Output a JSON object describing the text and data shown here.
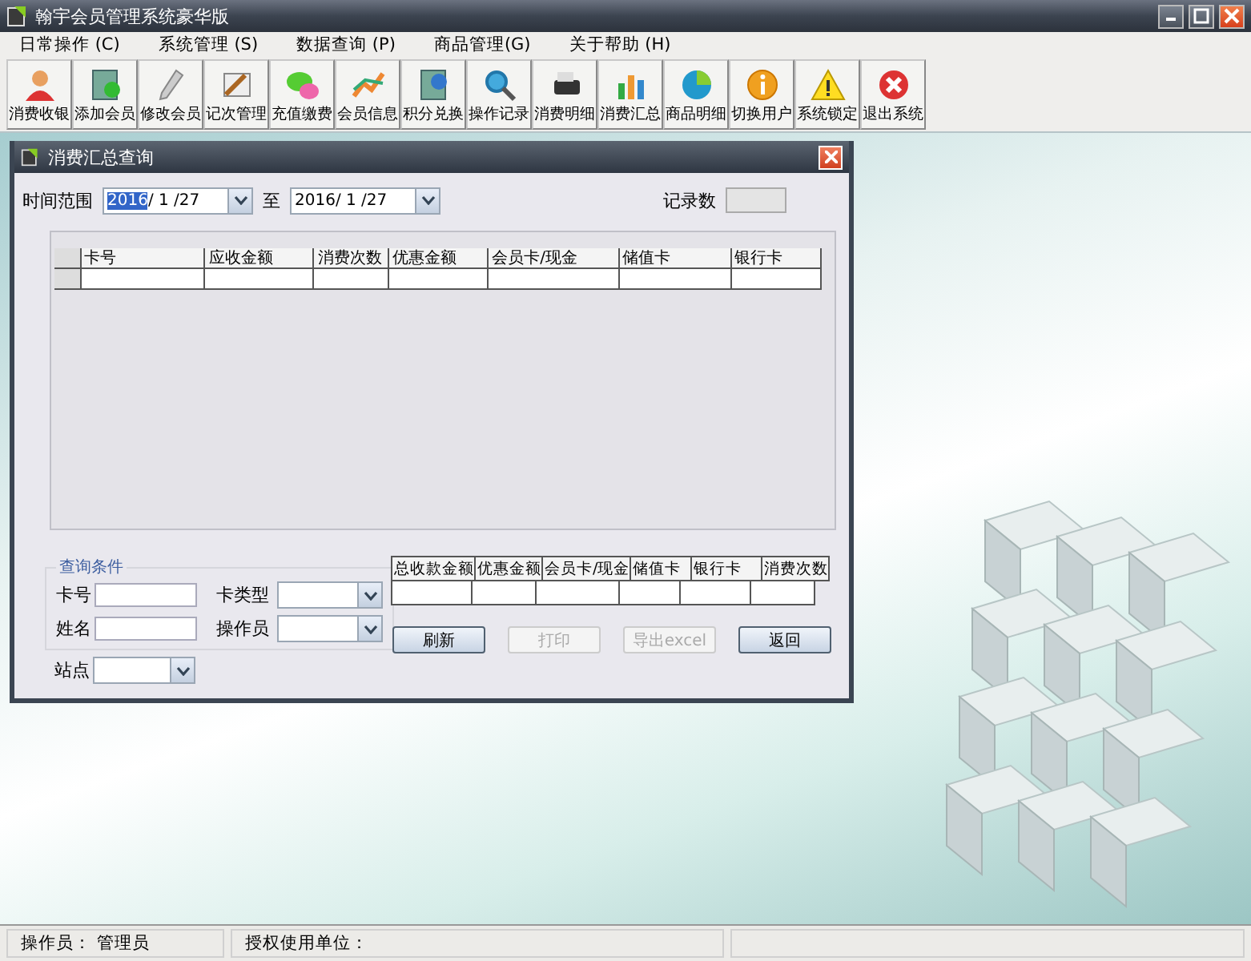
{
  "window": {
    "title": "翰宇会员管理系统豪华版"
  },
  "menu": [
    {
      "label": "日常操作 (C)"
    },
    {
      "label": "系统管理 (S)"
    },
    {
      "label": "数据查询 (P)"
    },
    {
      "label": "商品管理(G)"
    },
    {
      "label": "关于帮助 (H)"
    }
  ],
  "toolbar": [
    {
      "label": "消费收银"
    },
    {
      "label": "添加会员"
    },
    {
      "label": "修改会员"
    },
    {
      "label": "记次管理"
    },
    {
      "label": "充值缴费"
    },
    {
      "label": "会员信息"
    },
    {
      "label": "积分兑换"
    },
    {
      "label": "操作记录"
    },
    {
      "label": "消费明细"
    },
    {
      "label": "消费汇总"
    },
    {
      "label": "商品明细"
    },
    {
      "label": "切换用户"
    },
    {
      "label": "系统锁定"
    },
    {
      "label": "退出系统"
    }
  ],
  "dialog": {
    "title": "消费汇总查询",
    "time_range_label": "时间范围",
    "date_from": {
      "segments": [
        {
          "text": "2016",
          "selected": true
        },
        {
          "text": "/ 1 /27",
          "selected": false
        }
      ]
    },
    "to_label": "至",
    "date_to": {
      "segments": [
        {
          "text": "2016/ 1 /27",
          "selected": false
        }
      ]
    },
    "record_count_label": "记录数",
    "table": {
      "columns": [
        "卡号",
        "应收金额",
        "消费次数",
        "优惠金额",
        "会员卡/现金",
        "储值卡",
        "银行卡"
      ]
    },
    "criteria": {
      "title": "查询条件",
      "card_no_label": "卡号",
      "card_type_label": "卡类型",
      "name_label": "姓名",
      "operator_label": "操作员"
    },
    "station_label": "站点",
    "summary": {
      "columns": [
        "总收款金额",
        "优惠金额",
        "会员卡/现金",
        "储值卡",
        "银行卡",
        "消费次数"
      ]
    },
    "buttons": [
      {
        "label": "刷新",
        "disabled": false
      },
      {
        "label": "打印",
        "disabled": true
      },
      {
        "label": "导出excel",
        "disabled": true
      },
      {
        "label": "返回",
        "disabled": false
      }
    ]
  },
  "status_bar": [
    "操作员： 管理员",
    "授权使用单位："
  ]
}
